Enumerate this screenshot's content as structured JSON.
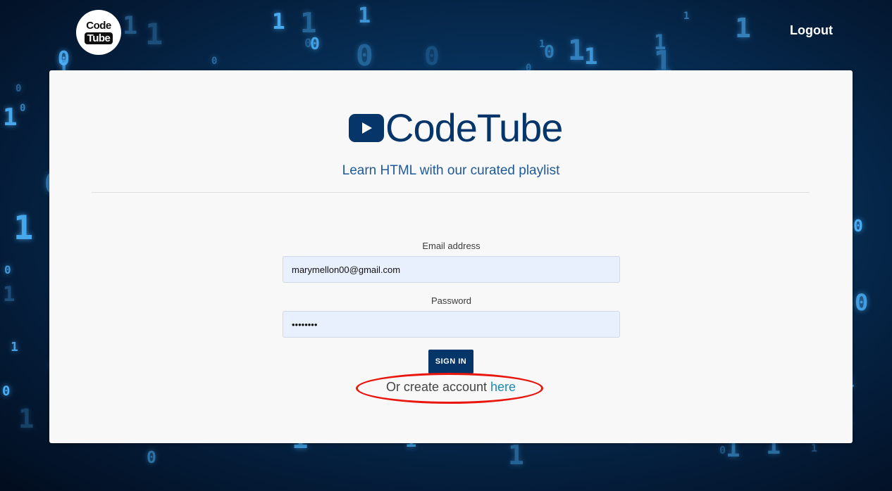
{
  "header": {
    "logo_top": "Code",
    "logo_bottom": "Tube",
    "logout_label": "Logout"
  },
  "card": {
    "brand_name": "CodeTube",
    "tagline": "Learn HTML with our curated playlist"
  },
  "form": {
    "email_label": "Email address",
    "email_value": "marymellon00@gmail.com",
    "password_label": "Password",
    "password_value": "passwd01",
    "signin_label": "SIGN IN",
    "create_prefix": "Or create account ",
    "create_link": "here"
  },
  "colors": {
    "brand": "#06356a",
    "link": "#1a8ab8",
    "annotation": "#e8160c"
  },
  "icons": [
    "play-icon"
  ]
}
